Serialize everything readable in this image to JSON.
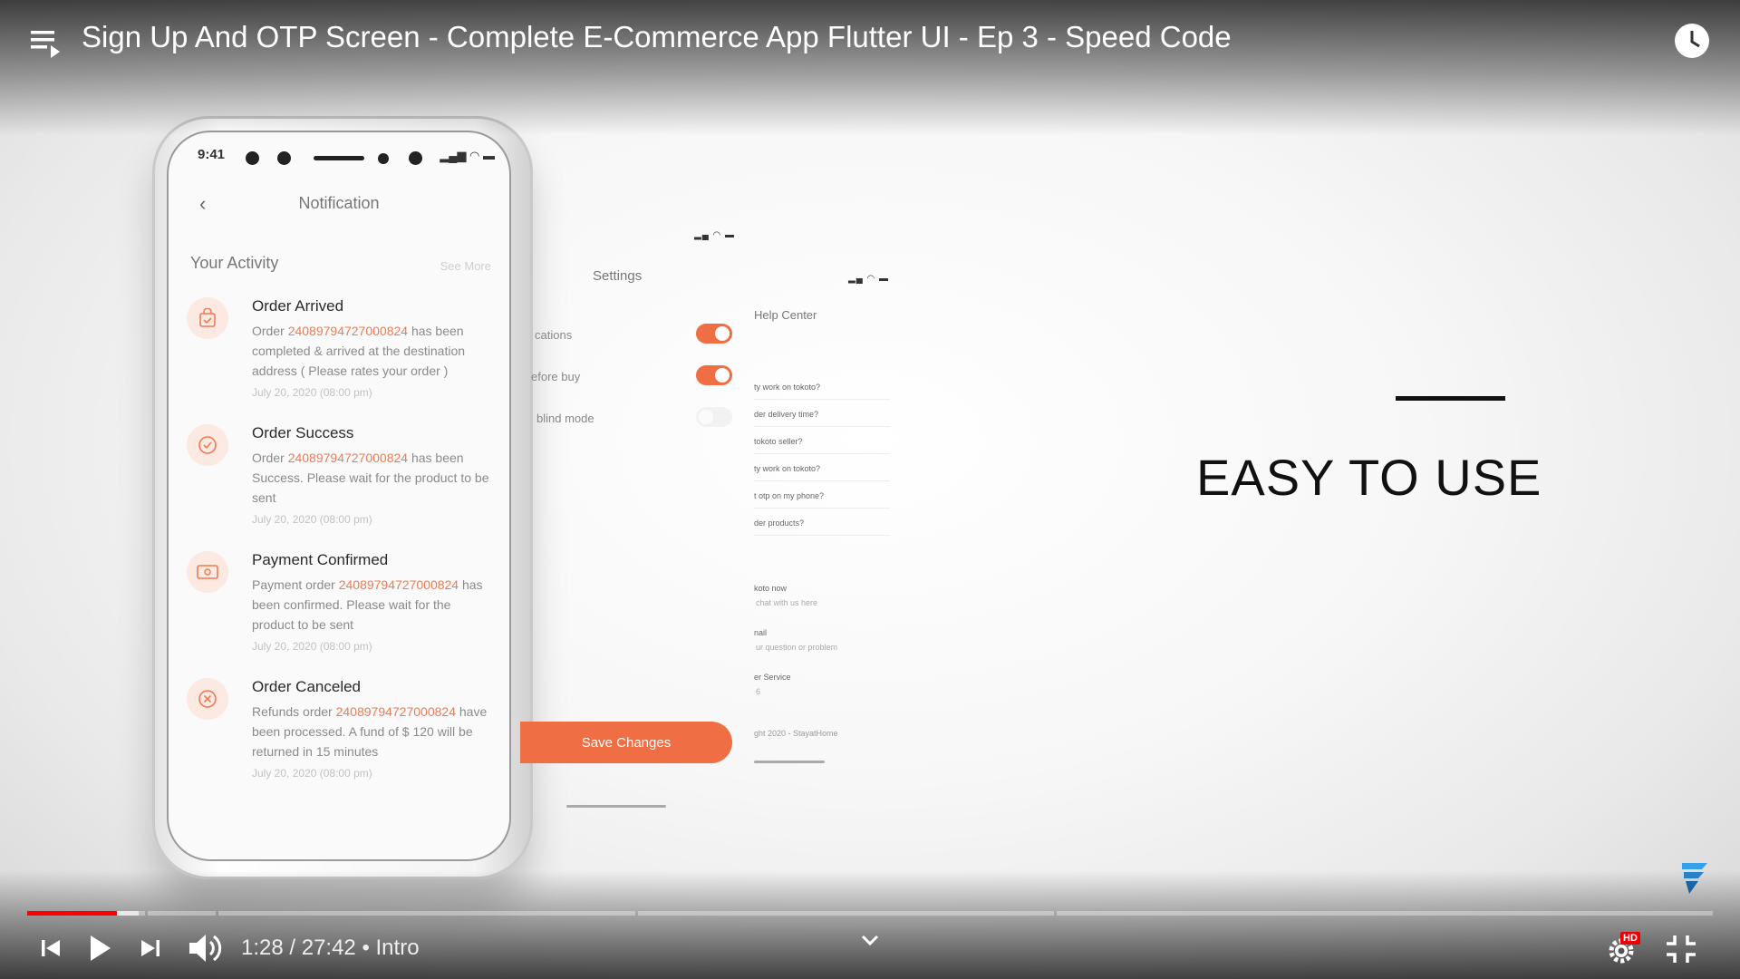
{
  "header": {
    "title": "Sign Up And OTP Screen - Complete E-Commerce App Flutter UI - Ep 3 - Speed Code"
  },
  "phone": {
    "status_time": "9:41",
    "screen_title": "Notification",
    "section_title": "Your Activity",
    "see_more": "See More",
    "items": [
      {
        "title": "Order Arrived",
        "pre": "Order ",
        "order_id": "24089794727000824",
        "post": " has been completed & arrived at the destination address ( Please rates your order )",
        "date": "July 20, 2020 (08:00 pm)",
        "icon": "bag-check-icon"
      },
      {
        "title": "Order Success",
        "pre": "Order ",
        "order_id": "24089794727000824",
        "post": " has been Success. Please wait for the product to be sent",
        "date": "July 20, 2020 (08:00 pm)",
        "icon": "check-circle-icon"
      },
      {
        "title": "Payment Confirmed",
        "pre": "Payment order ",
        "order_id": "24089794727000824",
        "post": " has been confirmed. Please wait for the product to be sent",
        "date": "July 20, 2020 (08:00 pm)",
        "icon": "payment-card-icon"
      },
      {
        "title": "Order Canceled",
        "pre": "Refunds order ",
        "order_id": "24089794727000824",
        "post": " have been processed. A fund of $ 120 will be returned in 15 minutes",
        "date": "July 20, 2020 (08:00 pm)",
        "icon": "close-circle-icon"
      }
    ]
  },
  "settings_screen": {
    "title": "Settings",
    "rows": [
      {
        "label": "cations",
        "state": "on"
      },
      {
        "label": "efore buy",
        "state": "on"
      },
      {
        "label": "blind mode",
        "state": "off"
      }
    ],
    "save_button": "Save Changes"
  },
  "help_screen": {
    "title": "Help Center",
    "faq": [
      "ty work on tokoto?",
      "der delivery time?",
      "tokoto seller?",
      "ty work on tokoto?",
      "t otp on my phone?",
      "der products?"
    ],
    "contacts": [
      {
        "label": "koto now",
        "sub": "chat with us here"
      },
      {
        "label": "nail",
        "sub": "ur question or problem"
      },
      {
        "label": "er Service",
        "sub": "6"
      }
    ],
    "copyright": "ght 2020 - StayatHome"
  },
  "tagline": "EASY TO USE",
  "player": {
    "current_time": "1:28",
    "duration": "27:42",
    "chapter": "Intro",
    "time_text": "1:28 / 27:42 • Intro",
    "hd_badge": "HD",
    "played_fraction": 0.053,
    "buffered_fraction": 0.066
  },
  "colors": {
    "accent": "#ef6e43",
    "progress_played": "#ff0000",
    "order_id_text": "#ef7a52"
  }
}
